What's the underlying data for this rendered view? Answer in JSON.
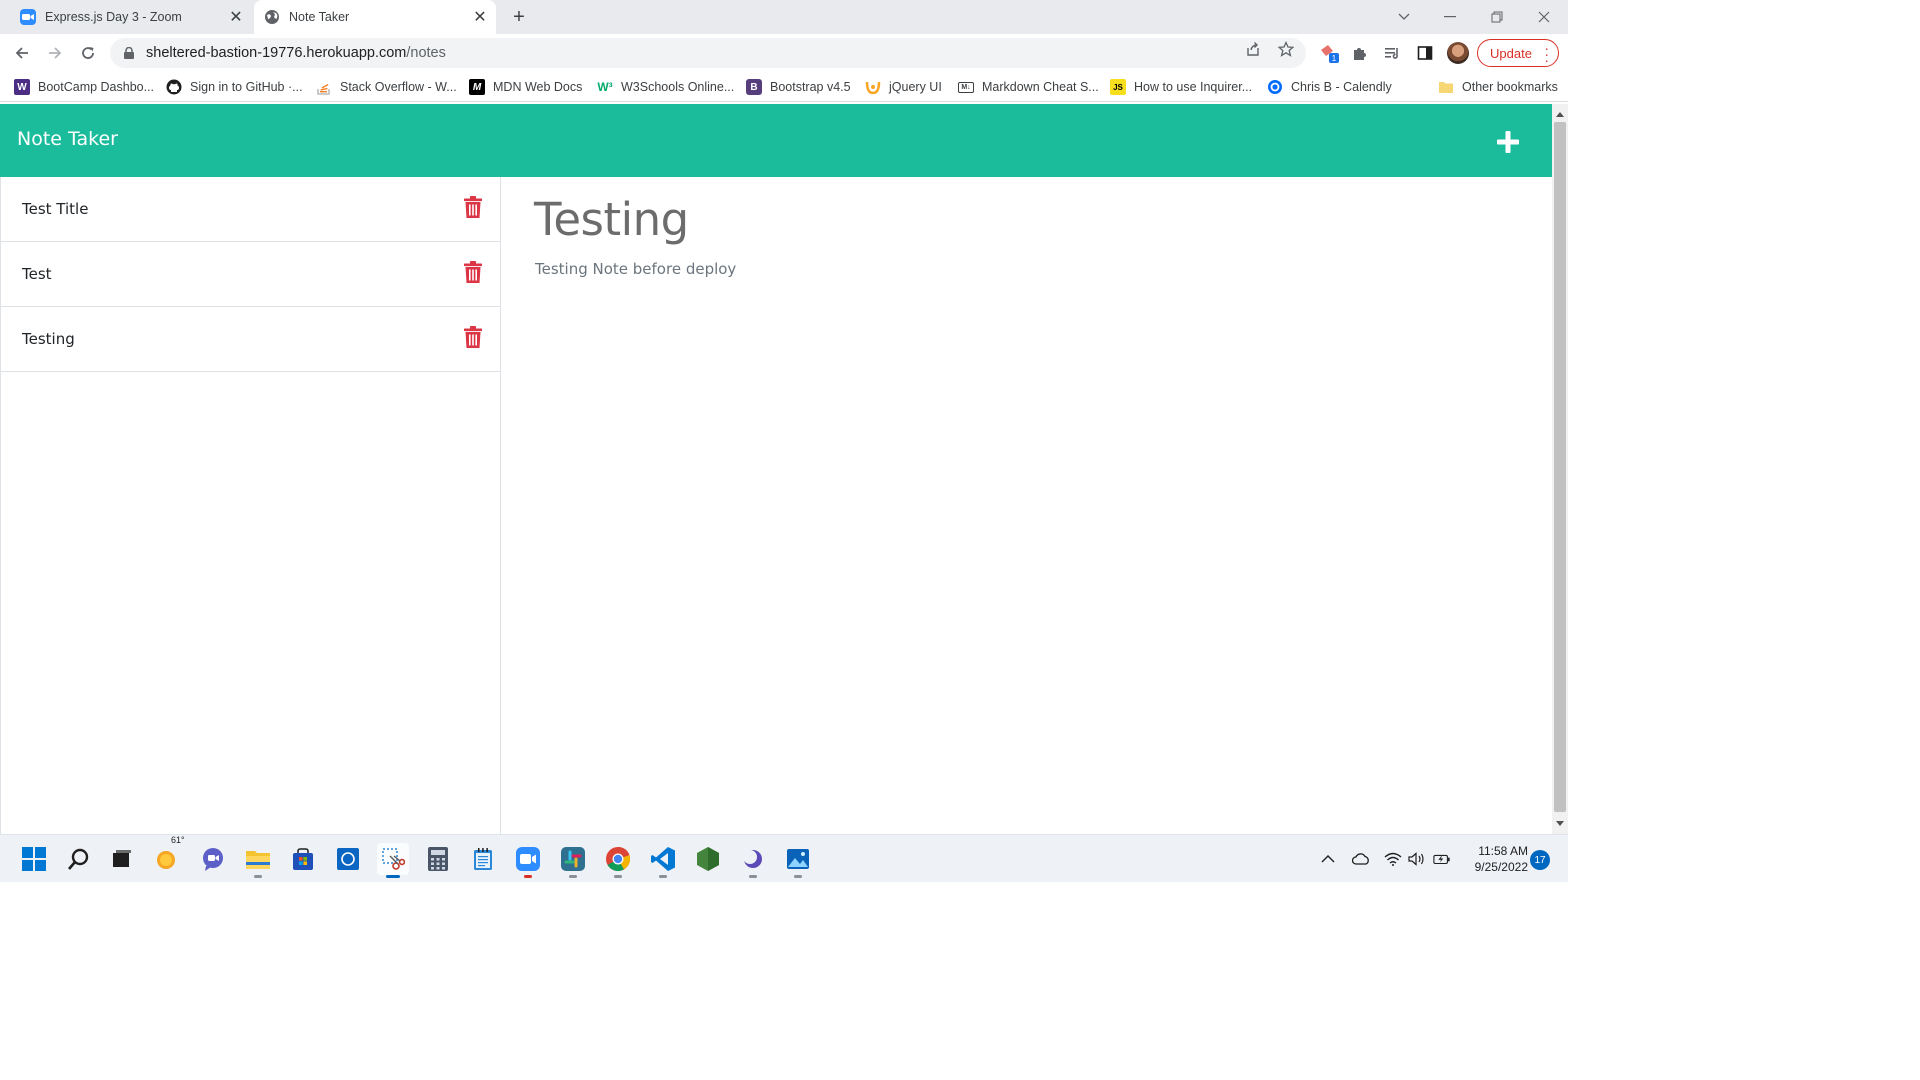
{
  "browser": {
    "tabs": [
      {
        "title": "Express.js Day 3 - Zoom",
        "icon": "zoom-icon",
        "active": false
      },
      {
        "title": "Note Taker",
        "icon": "globe-icon",
        "active": true
      }
    ],
    "url_host": "sheltered-bastion-19776.herokuapp.com",
    "url_path": "/notes",
    "update_label": "Update",
    "bookmarks": [
      {
        "label": "BootCamp Dashbo...",
        "icon": "W"
      },
      {
        "label": "Sign in to GitHub ·...",
        "icon": "github-icon"
      },
      {
        "label": "Stack Overflow - W...",
        "icon": "stackoverflow-icon"
      },
      {
        "label": "MDN Web Docs",
        "icon": "M"
      },
      {
        "label": "W3Schools Online...",
        "icon": "W3"
      },
      {
        "label": "Bootstrap v4.5",
        "icon": "B"
      },
      {
        "label": "jQuery UI",
        "icon": "jquery-icon"
      },
      {
        "label": "Markdown Cheat S...",
        "icon": "M↓"
      },
      {
        "label": "How to use Inquirer...",
        "icon": "JS"
      },
      {
        "label": "Chris B - Calendly",
        "icon": "calendly-icon"
      }
    ],
    "other_bookmarks": "Other bookmarks"
  },
  "app": {
    "brand": "Note Taker",
    "accent_color": "#1abc9c",
    "delete_color": "#dc3545",
    "notes": [
      {
        "title": "Test Title"
      },
      {
        "title": "Test"
      },
      {
        "title": "Testing"
      }
    ],
    "active_note": {
      "title": "Testing",
      "text": "Testing Note before deploy"
    }
  },
  "taskbar": {
    "weather_temp": "61°",
    "time": "11:58 AM",
    "date": "9/25/2022",
    "notification_count": "17"
  }
}
